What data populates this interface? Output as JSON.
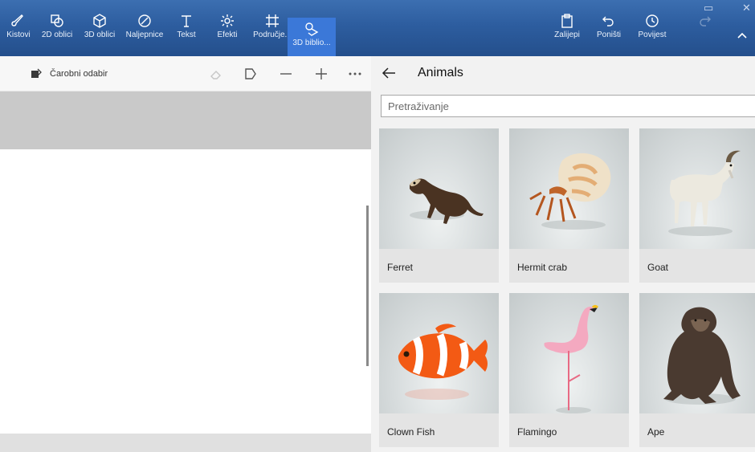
{
  "ribbon": {
    "tools": [
      {
        "label": "Kistovi",
        "icon": "brush-icon"
      },
      {
        "label": "2D oblici",
        "icon": "2d-shapes-icon"
      },
      {
        "label": "3D oblici",
        "icon": "3d-shapes-icon"
      },
      {
        "label": "Naljepnice",
        "icon": "stickers-icon"
      },
      {
        "label": "Tekst",
        "icon": "text-icon"
      },
      {
        "label": "Efekti",
        "icon": "effects-icon"
      },
      {
        "label": "Područje...",
        "icon": "canvas-icon"
      },
      {
        "label": "3D biblio...",
        "icon": "3d-library-icon"
      }
    ],
    "right_tools": [
      {
        "label": "Zalijepi",
        "icon": "paste-icon"
      },
      {
        "label": "Poništi",
        "icon": "undo-icon"
      },
      {
        "label": "Povijest",
        "icon": "history-icon"
      }
    ],
    "active_tool": "3D biblio..."
  },
  "left_toolbar": {
    "magic_select_label": "Čarobni odabir"
  },
  "library": {
    "title": "Animals",
    "search_placeholder": "Pretraživanje",
    "items": [
      {
        "name": "Ferret"
      },
      {
        "name": "Hermit crab"
      },
      {
        "name": "Goat"
      },
      {
        "name": "Clown Fish"
      },
      {
        "name": "Flamingo"
      },
      {
        "name": "Ape"
      }
    ]
  },
  "colors": {
    "ribbon": "#2d5d9f",
    "active_tool": "#3b78d8",
    "panel_bg": "#f2f2f2"
  }
}
